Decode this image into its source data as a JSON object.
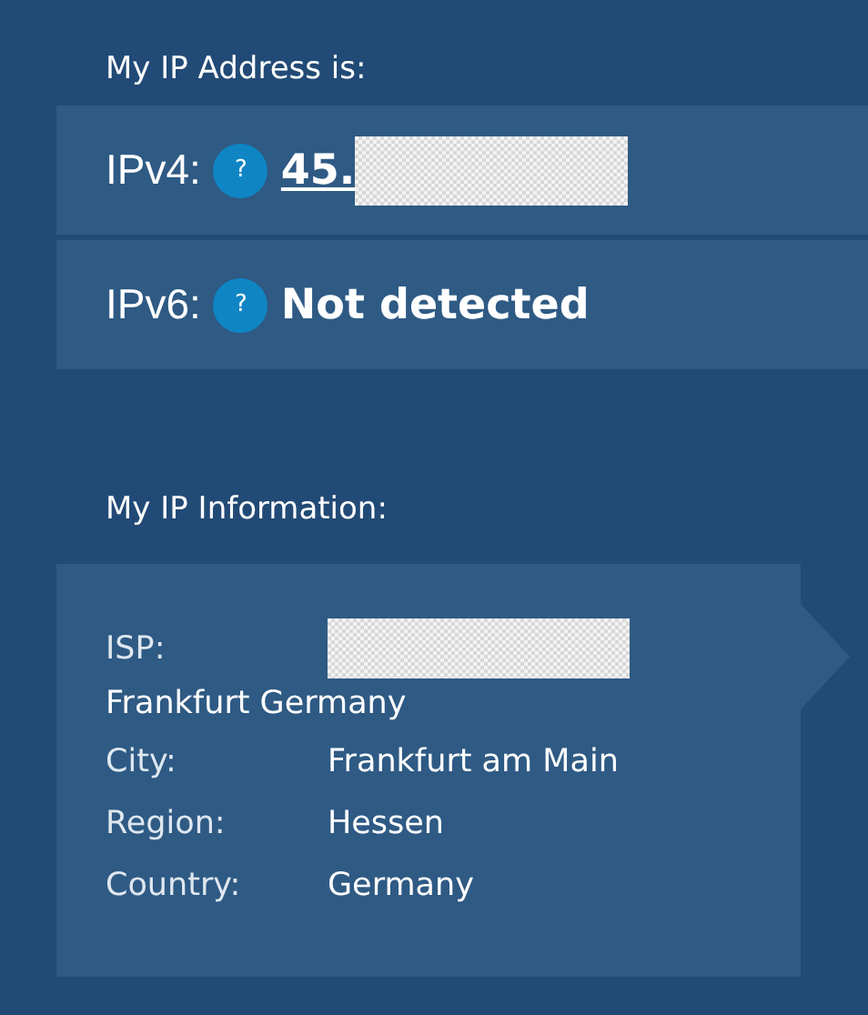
{
  "address_heading": "My IP Address is:",
  "addresses": [
    {
      "label": "IPv4:",
      "help_icon": "?",
      "value": "45.",
      "link": true,
      "redacted": true
    },
    {
      "label": "IPv6:",
      "help_icon": "?",
      "value": "Not detected",
      "link": false,
      "redacted": false
    }
  ],
  "info_heading": "My IP Information:",
  "info": [
    {
      "label": "ISP:",
      "redacted": true,
      "value": "Frankfurt Germany",
      "kind": "wrapped"
    },
    {
      "label": "City:",
      "redacted": false,
      "value": "Frankfurt am Main",
      "kind": "inline"
    },
    {
      "label": "Region:",
      "redacted": false,
      "value": "Hessen",
      "kind": "inline"
    },
    {
      "label": "Country:",
      "redacted": false,
      "value": "Germany",
      "kind": "inline"
    }
  ]
}
